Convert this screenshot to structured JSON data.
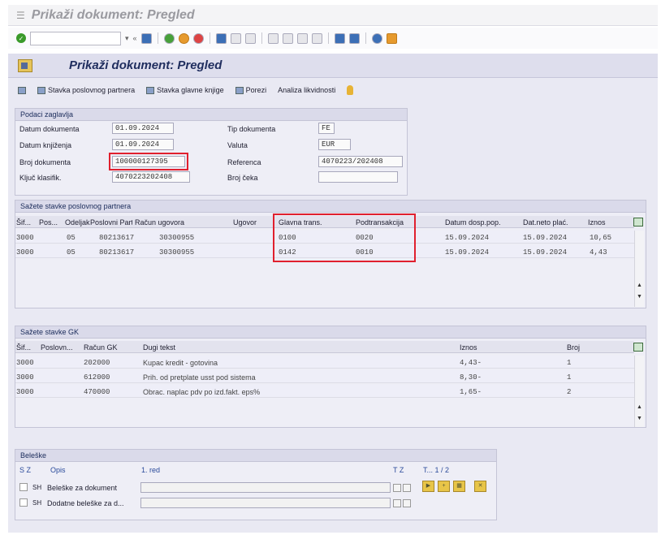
{
  "window": {
    "title": "Prikaži dokument: Pregled"
  },
  "screen": {
    "title": "Prikaži dokument: Pregled"
  },
  "toolbar": {
    "items": [
      {
        "label": "Stavka poslovnog partnera",
        "icon": "table-icon"
      },
      {
        "label": "Stavka glavne knjige",
        "icon": "table-icon"
      },
      {
        "label": "Porezi",
        "icon": "table-icon"
      },
      {
        "label": "Analiza likvidnosti",
        "icon": "lightbulb-icon"
      }
    ]
  },
  "header": {
    "title": "Podaci zaglavlja",
    "fields": {
      "doc_date": {
        "label": "Datum dokumenta",
        "value": "01.09.2024"
      },
      "post_date": {
        "label": "Datum knjiženja",
        "value": "01.09.2024"
      },
      "doc_number": {
        "label": "Broj dokumenta",
        "value": "100000127395"
      },
      "class_key": {
        "label": "Ključ klasifik.",
        "value": "4070223202408"
      },
      "doc_type": {
        "label": "Tip dokumenta",
        "value": "FE"
      },
      "currency": {
        "label": "Valuta",
        "value": "EUR"
      },
      "reference": {
        "label": "Referenca",
        "value": "4070223/202408"
      },
      "cheque_no": {
        "label": "Broj čeka",
        "value": ""
      }
    }
  },
  "bp": {
    "title": "Sažete stavke poslovnog partnera",
    "columns": [
      "Šif...",
      "Pos...",
      "Odeljak",
      "Poslovni Partner",
      "Račun ugovora",
      "Ugovor",
      "Glavna trans.",
      "Podtransakcija",
      "Datum dosp.pop.",
      "Dat.neto plać.",
      "Iznos"
    ],
    "rows": [
      [
        "3000",
        "05",
        "80213617",
        "30300955",
        "",
        "0100",
        "0020",
        "15.09.2024",
        "15.09.2024",
        "10,65"
      ],
      [
        "3000",
        "05",
        "80213617",
        "30300955",
        "",
        "0142",
        "0010",
        "15.09.2024",
        "15.09.2024",
        "4,43"
      ]
    ]
  },
  "gl": {
    "title": "Sažete stavke GK",
    "columns": [
      "Šif...",
      "Poslovn...",
      "Račun GK",
      "Dugi tekst",
      "Iznos",
      "Broj"
    ],
    "rows": [
      [
        "3000",
        "",
        "202000",
        "Kupac kredit - gotovina",
        "4,43-",
        "1"
      ],
      [
        "3000",
        "",
        "612000",
        "Prih. od pretplate usst pod sistema",
        "8,30-",
        "1"
      ],
      [
        "3000",
        "",
        "470000",
        "Obrac. naplac pdv po izd.fakt. eps%",
        "1,65-",
        "2"
      ]
    ]
  },
  "notes": {
    "title": "Beleške",
    "col_sz": "S Z",
    "col_desc": "Opis",
    "col_line": "1. red",
    "col_tz": "T Z",
    "pager": "T...  1 / 2",
    "rows": [
      {
        "num": "SH",
        "label": "Beleške za dokument"
      },
      {
        "num": "SH",
        "label": "Dodatne beleške za d..."
      }
    ]
  }
}
